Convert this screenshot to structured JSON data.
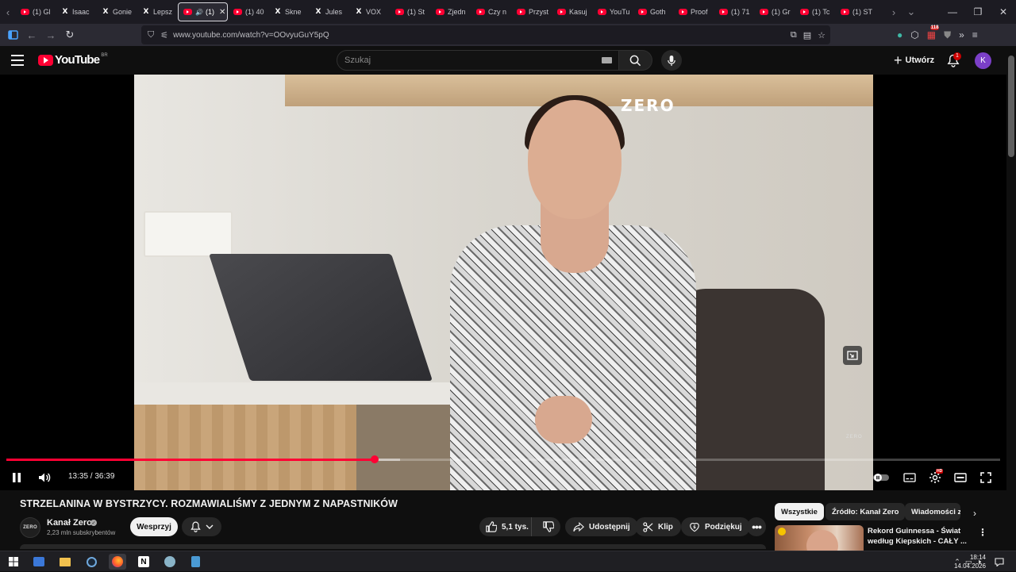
{
  "browser": {
    "tabs": [
      {
        "icon": "youtube",
        "label": "(1) Gl"
      },
      {
        "icon": "x",
        "label": "Isaac"
      },
      {
        "icon": "x",
        "label": "Gonie"
      },
      {
        "icon": "x",
        "label": "Lepsz"
      },
      {
        "icon": "youtube",
        "label": "(1)",
        "active": true
      },
      {
        "icon": "youtube",
        "label": "(1) 40"
      },
      {
        "icon": "x",
        "label": "Skne"
      },
      {
        "icon": "x",
        "label": "Jules"
      },
      {
        "icon": "x",
        "label": "VOX"
      },
      {
        "icon": "youtube",
        "label": "(1) St"
      },
      {
        "icon": "youtube",
        "label": "Zjedn"
      },
      {
        "icon": "youtube",
        "label": "Czy n"
      },
      {
        "icon": "youtube",
        "label": "Przyst"
      },
      {
        "icon": "youtube",
        "label": "Kasuj"
      },
      {
        "icon": "youtube",
        "label": "YouTu"
      },
      {
        "icon": "youtube",
        "label": "Goth"
      },
      {
        "icon": "youtube",
        "label": "Proof"
      },
      {
        "icon": "youtube",
        "label": "(1) 71"
      },
      {
        "icon": "youtube",
        "label": "(1) Gr"
      },
      {
        "icon": "youtube",
        "label": "(1) Tc"
      },
      {
        "icon": "youtube",
        "label": "(1) ST"
      }
    ],
    "url": "www.youtube.com/watch?v=OOvyuGuY5pQ",
    "extension_badge": "118"
  },
  "youtube": {
    "logo_text": "YouTube",
    "region": "BR",
    "search_placeholder": "Szukaj",
    "create_label": "Utwórz",
    "notification_count": "1",
    "avatar_letter": "K"
  },
  "player": {
    "watermark": "ZERO",
    "watermark_small": "ZERO",
    "current_time": "13:35",
    "duration": "36:39",
    "played_fraction": 0.371,
    "buffered_fraction": 0.396,
    "settings_badge": "HD"
  },
  "video": {
    "title": "STRZELANINA W BYSTRZYCY. ROZMAWIALIŚMY Z JEDNYM Z NAPASTNIKÓW",
    "channel_name": "Kanał Zero",
    "channel_avatar": "ZERO",
    "subscribers": "2,23 mln subskrybentów",
    "support_label": "Wesprzyj",
    "likes": "5,1 tys.",
    "share_label": "Udostępnij",
    "clip_label": "Klip",
    "thanks_label": "Podziękuj"
  },
  "sidebar": {
    "chips": [
      "Wszystkie",
      "Źródło: Kanał Zero",
      "Wiadomości z"
    ],
    "rec_title": "Rekord Guinnessa - Świat według Kiepskich - CAŁY ..."
  },
  "taskbar": {
    "time": "18:14",
    "date": "14.04.2026"
  }
}
